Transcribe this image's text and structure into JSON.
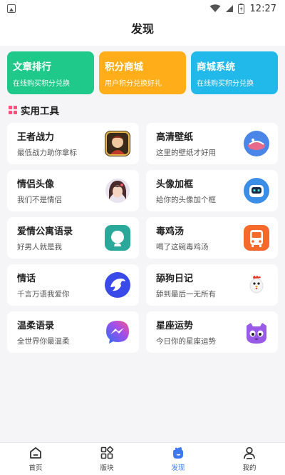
{
  "status_bar": {
    "time": "12:27"
  },
  "header": {
    "title": "发现"
  },
  "banners": [
    {
      "title": "文章排行",
      "subtitle": "在线购买积分兑换",
      "color": "#1ec98a"
    },
    {
      "title": "积分商城",
      "subtitle": "用户积分兑换好礼",
      "color": "#ffae1a"
    },
    {
      "title": "商城系统",
      "subtitle": "在线购买积分兑换",
      "color": "#21b8ea"
    }
  ],
  "tools_section": {
    "title": "实用工具"
  },
  "tools": [
    {
      "title": "王者战力",
      "subtitle": "最低战力助你拿标",
      "icon": "game-hero-icon"
    },
    {
      "title": "高清壁纸",
      "subtitle": "这里的壁纸才好用",
      "icon": "wallpaper-icon"
    },
    {
      "title": "情侣头像",
      "subtitle": "我们不是情侣",
      "icon": "couple-avatar-icon"
    },
    {
      "title": "头像加框",
      "subtitle": "给你的头像加个框",
      "icon": "robot-frame-icon"
    },
    {
      "title": "爱情公寓语录",
      "subtitle": "好男人就是我",
      "icon": "shell-icon"
    },
    {
      "title": "毒鸡汤",
      "subtitle": "喝了这碗毒鸡汤",
      "icon": "bus-icon"
    },
    {
      "title": "情话",
      "subtitle": "千言万语我爱你",
      "icon": "dolphin-icon"
    },
    {
      "title": "舔狗日记",
      "subtitle": "舔到最后一无所有",
      "icon": "rooster-icon"
    },
    {
      "title": "温柔语录",
      "subtitle": "全世界你最温柔",
      "icon": "messenger-icon"
    },
    {
      "title": "星座运势",
      "subtitle": "今日你的星座运势",
      "icon": "purple-cat-icon"
    }
  ],
  "tabbar": {
    "items": [
      {
        "label": "首页",
        "icon": "home-icon"
      },
      {
        "label": "版块",
        "icon": "blocks-icon"
      },
      {
        "label": "发现",
        "icon": "discover-icon",
        "active": true
      },
      {
        "label": "我的",
        "icon": "user-icon"
      }
    ],
    "active_color": "#3c78f0"
  }
}
